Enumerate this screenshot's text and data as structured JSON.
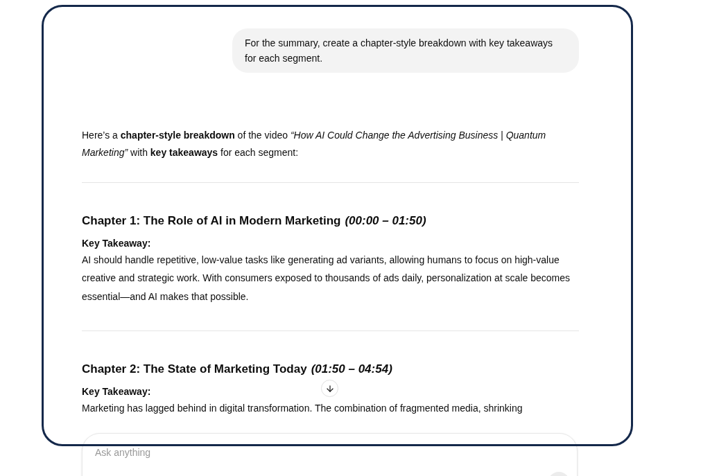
{
  "user_message": "For the summary, create a chapter-style breakdown with key takeaways for each segment.",
  "response": {
    "intro": "Here’s a **chapter-style breakdown** of the video *“How AI Could Change the Advertising Business | Quantum Marketing”* with **key takeaways** for each segment:",
    "chapters": [
      {
        "title": "Chapter 1: The Role of AI in Modern Marketing",
        "time": "(00:00 – 01:50)",
        "label": "Key Takeaway:",
        "text": "AI should handle repetitive, low-value tasks like generating ad variants, allowing humans to focus on high-value creative and strategic work. With consumers exposed to thousands of ads daily, personalization at scale becomes essential—and AI makes that possible."
      },
      {
        "title": "Chapter 2: The State of Marketing Today",
        "time": "(01:50 – 04:54)",
        "label": "Key Takeaway:",
        "text": "Marketing has lagged behind in digital transformation. The combination of fragmented media, shrinking"
      }
    ]
  },
  "composer": {
    "placeholder": "Ask anything"
  }
}
